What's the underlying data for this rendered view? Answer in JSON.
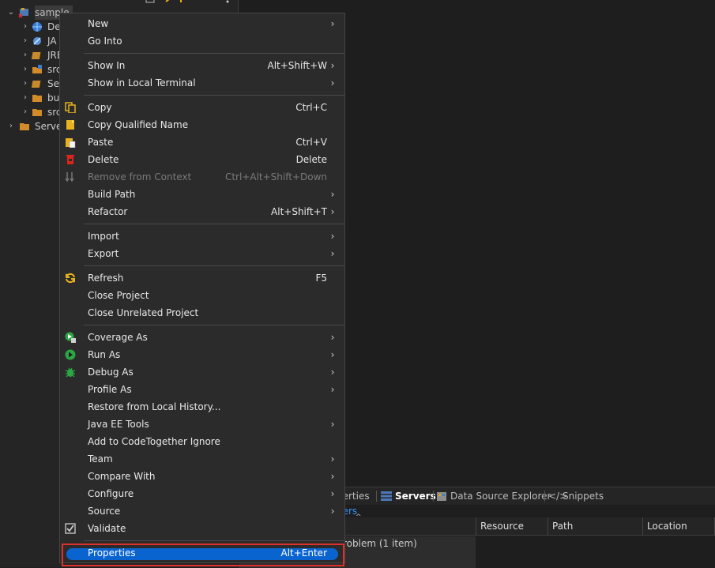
{
  "explorer": {
    "tree": [
      {
        "label": "sample",
        "expanded": true,
        "icon": "project-error-icon"
      },
      {
        "label": "De",
        "icon": "deployment-descriptor-icon"
      },
      {
        "label": "JA",
        "icon": "jax-ws-icon"
      },
      {
        "label": "JRE",
        "icon": "library-icon"
      },
      {
        "label": "src",
        "icon": "source-folder-icon"
      },
      {
        "label": "Se",
        "icon": "library-icon"
      },
      {
        "label": "bu",
        "icon": "folder-icon"
      },
      {
        "label": "src",
        "icon": "folder-icon"
      },
      {
        "label": "Serve",
        "icon": "folder-icon"
      }
    ]
  },
  "menu": {
    "items": [
      {
        "label": "New",
        "shortcut": "",
        "submenu": true
      },
      {
        "label": "Go Into",
        "shortcut": "",
        "submenu": false
      },
      {
        "label": "Show In",
        "shortcut": "Alt+Shift+W",
        "submenu": true
      },
      {
        "label": "Show in Local Terminal",
        "shortcut": "",
        "submenu": true
      },
      {
        "label": "Copy",
        "shortcut": "Ctrl+C",
        "submenu": false,
        "icon": "copy-icon"
      },
      {
        "label": "Copy Qualified Name",
        "shortcut": "",
        "submenu": false,
        "icon": "copy-qualified-name-icon"
      },
      {
        "label": "Paste",
        "shortcut": "Ctrl+V",
        "submenu": false,
        "icon": "paste-icon"
      },
      {
        "label": "Delete",
        "shortcut": "Delete",
        "submenu": false,
        "icon": "delete-icon"
      },
      {
        "label": "Remove from Context",
        "shortcut": "Ctrl+Alt+Shift+Down",
        "submenu": false,
        "disabled": true,
        "icon": "remove-from-context-icon"
      },
      {
        "label": "Build Path",
        "shortcut": "",
        "submenu": true
      },
      {
        "label": "Refactor",
        "shortcut": "Alt+Shift+T",
        "submenu": true
      },
      {
        "label": "Import",
        "shortcut": "",
        "submenu": true
      },
      {
        "label": "Export",
        "shortcut": "",
        "submenu": true
      },
      {
        "label": "Refresh",
        "shortcut": "F5",
        "submenu": false,
        "icon": "refresh-icon"
      },
      {
        "label": "Close Project",
        "shortcut": "",
        "submenu": false
      },
      {
        "label": "Close Unrelated Project",
        "shortcut": "",
        "submenu": false
      },
      {
        "label": "Coverage As",
        "shortcut": "",
        "submenu": true,
        "icon": "coverage-icon"
      },
      {
        "label": "Run As",
        "shortcut": "",
        "submenu": true,
        "icon": "run-icon"
      },
      {
        "label": "Debug As",
        "shortcut": "",
        "submenu": true,
        "icon": "debug-icon"
      },
      {
        "label": "Profile As",
        "shortcut": "",
        "submenu": true
      },
      {
        "label": "Restore from Local History...",
        "shortcut": "",
        "submenu": false
      },
      {
        "label": "Java EE Tools",
        "shortcut": "",
        "submenu": true
      },
      {
        "label": "Add to CodeTogether Ignore",
        "shortcut": "",
        "submenu": false
      },
      {
        "label": "Team",
        "shortcut": "",
        "submenu": true
      },
      {
        "label": "Compare With",
        "shortcut": "",
        "submenu": true
      },
      {
        "label": "Configure",
        "shortcut": "",
        "submenu": true
      },
      {
        "label": "Source",
        "shortcut": "",
        "submenu": true
      },
      {
        "label": "Validate",
        "shortcut": "",
        "submenu": false,
        "icon": "validate-icon"
      },
      {
        "label": "Properties",
        "shortcut": "Alt+Enter",
        "submenu": false,
        "highlighted": true
      }
    ]
  },
  "bottom_panel": {
    "tabs": [
      {
        "label": "perties",
        "icon": ""
      },
      {
        "label": "Servers",
        "icon": "servers-icon",
        "active": true
      },
      {
        "label": "Data Source Explorer",
        "icon": "data-source-icon"
      },
      {
        "label": "Snippets",
        "icon": "snippets-icon"
      }
    ],
    "subtitle": "ners",
    "columns": [
      "Resource",
      "Path",
      "Location"
    ],
    "problem_summary": "roblem (1 item)"
  },
  "colors": {
    "menu_bg": "#2b2b2b",
    "highlight": "#0a64cf",
    "annotation_red": "#e0302b"
  }
}
